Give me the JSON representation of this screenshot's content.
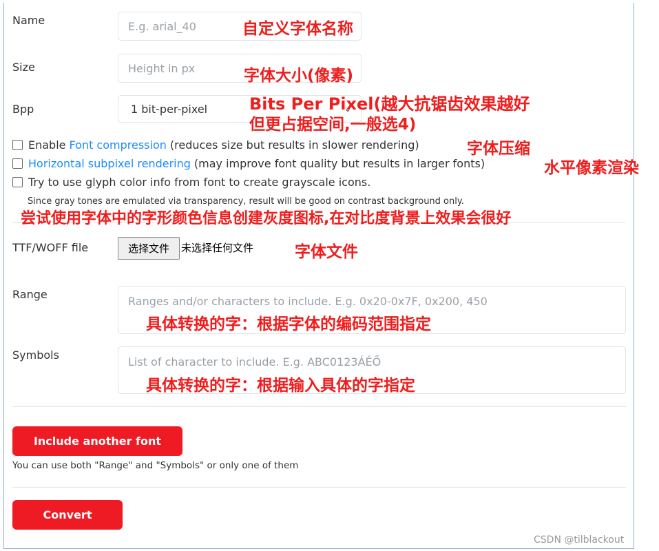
{
  "form": {
    "name_label": "Name",
    "name_placeholder": "E.g. arial_40",
    "size_label": "Size",
    "size_placeholder": "Height in px",
    "bpp_label": "Bpp",
    "bpp_value": "1 bit-per-pixel",
    "compression_prefix": "Enable ",
    "compression_link": "Font compression",
    "compression_suffix": " (reduces size but results in slower rendering)",
    "subpixel_link": "Horizontal subpixel rendering",
    "subpixel_suffix": " (may improve font quality but results in larger fonts)",
    "grayscale_label": "Try to use glyph color info from font to create grayscale icons.",
    "grayscale_note": "Since gray tones are emulated via transparency, result will be good on contrast background only.",
    "file_label": "TTF/WOFF file",
    "file_button": "选择文件",
    "file_status": "未选择任何文件",
    "range_label": "Range",
    "range_placeholder": "Ranges and/or characters to include. E.g. 0x20-0x7F, 0x200, 450",
    "symbols_label": "Symbols",
    "symbols_placeholder": "List of character to include. E.g. ABC0123ÁÉŐ",
    "include_button": "Include another font",
    "include_hint": "You can use both \"Range\" and \"Symbols\" or only one of them",
    "convert_button": "Convert"
  },
  "annotations": {
    "name": "自定义字体名称",
    "size": "字体大小(像素)",
    "bpp_1": "Bits Per Pixel(越大抗锯齿效果越好",
    "bpp_2": "但更占据空间,一般选4)",
    "compression": "字体压缩",
    "subpixel": "水平像素渲染",
    "grayscale": "尝试使用字体中的字形颜色信息创建灰度图标,在对比度背景上效果会很好",
    "file": "字体文件",
    "range": "具体转换的字：根据字体的编码范围指定",
    "symbols": "具体转换的字：根据输入具体的字指定"
  },
  "watermark": "CSDN @tilblackout",
  "colors": {
    "accent": "#ef1b24",
    "link": "#1a8cff",
    "annotation": "#f01d1d"
  }
}
